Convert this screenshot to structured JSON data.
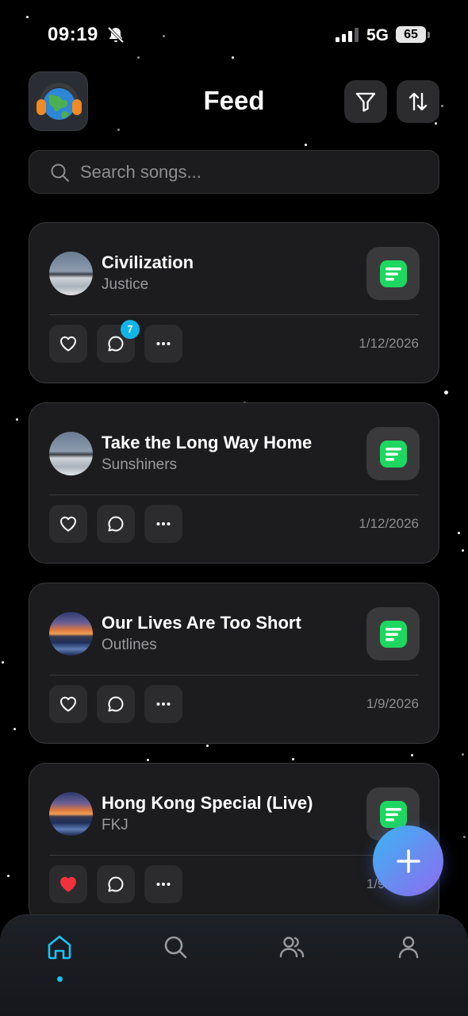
{
  "status_bar": {
    "time": "09:19",
    "network": "5G",
    "battery": "65"
  },
  "header": {
    "title": "Feed",
    "logo_icon": "globe-headphones-icon",
    "filter_icon": "filter-icon",
    "sort_icon": "sort-icon"
  },
  "search": {
    "placeholder": "Search songs...",
    "value": ""
  },
  "feed": [
    {
      "title": "Civilization",
      "artist": "Justice",
      "date": "1/12/2026",
      "liked": false,
      "comment_count": "7",
      "art": "winter-landscape"
    },
    {
      "title": "Take the Long Way Home",
      "artist": "Sunshiners",
      "date": "1/12/2026",
      "liked": false,
      "art": "winter-landscape"
    },
    {
      "title": "Our Lives Are Too Short",
      "artist": "Outlines",
      "date": "1/9/2026",
      "liked": false,
      "art": "sunset-sea"
    },
    {
      "title": "Hong Kong Special (Live)",
      "artist": "FKJ",
      "date": "1/9/2026",
      "liked": true,
      "art": "sunset-sea"
    }
  ],
  "fab": {
    "icon": "plus-icon"
  },
  "tab_bar": {
    "active": "home",
    "tabs": [
      "home-icon",
      "search-icon",
      "friends-icon",
      "profile-icon"
    ]
  },
  "colors": {
    "accent": "#19c3f2",
    "spotify_green": "#1ed760",
    "liked_red": "#f0323c",
    "badge": "#11b4e6"
  }
}
